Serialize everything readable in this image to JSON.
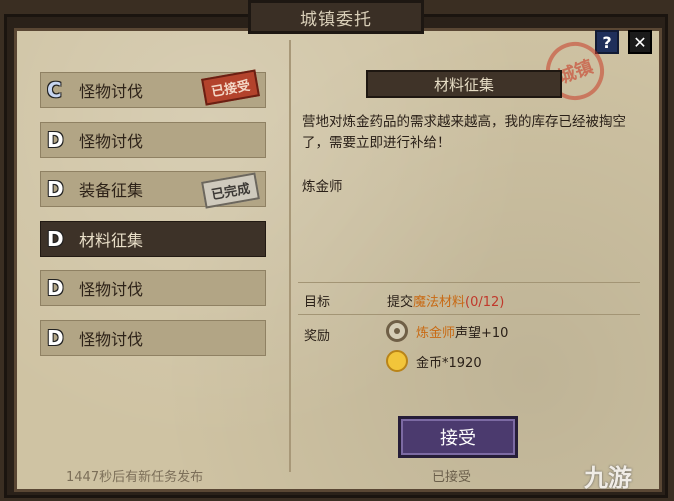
{
  "title": "城镇委托",
  "help_label": "?",
  "close_label": "✕",
  "quests": [
    {
      "rank": "C",
      "name": "怪物讨伐",
      "stamp": "已接受"
    },
    {
      "rank": "D",
      "name": "怪物讨伐",
      "stamp": ""
    },
    {
      "rank": "D",
      "name": "装备征集",
      "stamp": "已完成"
    },
    {
      "rank": "D",
      "name": "材料征集",
      "stamp": ""
    },
    {
      "rank": "D",
      "name": "怪物讨伐",
      "stamp": ""
    },
    {
      "rank": "D",
      "name": "怪物讨伐",
      "stamp": ""
    }
  ],
  "refresh_text": "1447秒后有新任务发布",
  "detail": {
    "title": "材料征集",
    "description": "营地对炼金药品的需求越来越高，我的库存已经被掏空了，需要立即进行补给！",
    "giver": "炼金师",
    "goal_label": "目标",
    "goal_prefix": "提交",
    "goal_item": "魔法材料",
    "goal_progress": "(0/12)",
    "reward_label": "奖励",
    "reward_reputation_name": "炼金师",
    "reward_reputation_text": "声望+10",
    "reward_gold": "金币*1920",
    "seal_text": "城镇"
  },
  "accept_button": "接受",
  "accept_status": "已接受",
  "watermark": "九游",
  "colors": {
    "accent_orange": "#c86a14",
    "progress_red": "#c0392b",
    "button_purple": "#4b3a6e"
  }
}
